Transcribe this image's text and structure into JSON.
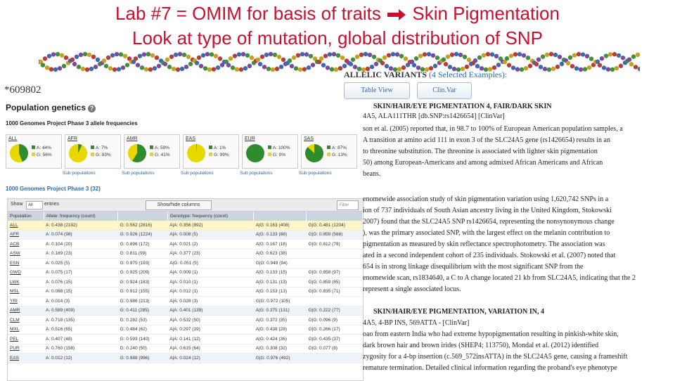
{
  "slide": {
    "title_line1_pre": "Lab #7 = OMIM for basis of traits",
    "title_line1_post": " Skin Pigmentation",
    "title_line2": "Look at type of mutation, global distribution of SNP",
    "title_color": "#c8102e"
  },
  "left": {
    "mim_number": "*609802",
    "pop_gen_title": "Population genetics",
    "kg_label": "1000 Genomes Project Phase 3 allele frequencies",
    "populations": [
      {
        "name": "ALL",
        "a": "A: 44%",
        "g": "G: 56%",
        "a_frac": 0.44
      },
      {
        "name": "AFR",
        "a": "A: 7%",
        "g": "G: 93%",
        "a_frac": 0.07
      },
      {
        "name": "AMR",
        "a": "A: 59%",
        "g": "G: 41%",
        "a_frac": 0.59
      },
      {
        "name": "EAS",
        "a": "A: 1%",
        "g": "G: 99%",
        "a_frac": 0.01
      },
      {
        "name": "EUR",
        "a": "A: 100%",
        "g": "G: 0%",
        "a_frac": 1.0
      },
      {
        "name": "SAS",
        "a": "A: 87%",
        "g": "G: 13%",
        "a_frac": 0.87
      }
    ],
    "subpop_label": "Sub populations",
    "kg32_label": "1000 Genomes Project Phase 3 (32)",
    "table_bar": {
      "show": "Show",
      "select": "All",
      "entries": "entries",
      "show_cols": "Show/hide columns",
      "filter": "Filter"
    },
    "headers": [
      "Population",
      "Allele: frequency (count)",
      "",
      "Genotype: frequency (count)",
      "",
      ""
    ],
    "rows": [
      {
        "cls": "hl",
        "pop": "ALL",
        "a": "A: 0.438 (2192)",
        "g": "G: 0.562 (2816)",
        "aa": "A|A: 0.356 (892)",
        "ag": "A|G: 0.163 (408)",
        "gg": "G|G: 0.481 (1204)"
      },
      {
        "cls": "sub",
        "pop": "AFR",
        "a": "A: 0.074 (98)",
        "g": "G: 0.926 (1224)",
        "aa": "A|A: 0.008 (5)",
        "ag": "A|G: 0.133 (88)",
        "gg": "G|G: 0.859 (568)"
      },
      {
        "cls": "",
        "pop": "ACB",
        "a": "A: 0.104 (20)",
        "g": "G: 0.896 (172)",
        "aa": "A|A: 0.021 (2)",
        "ag": "A|G: 0.167 (16)",
        "gg": "G|G: 0.812 (78)"
      },
      {
        "cls": "",
        "pop": "ASW",
        "a": "A: 0.189 (23)",
        "g": "G: 0.811 (99)",
        "aa": "A|A: 0.377 (23)",
        "ag": "A|G: 0.623 (38)",
        "gg": ""
      },
      {
        "cls": "",
        "pop": "ESN",
        "a": "A: 0.025 (5)",
        "g": "G: 0.975 (193)",
        "aa": "A|G: 0.051 (5)",
        "ag": "G|G: 0.949 (94)",
        "gg": ""
      },
      {
        "cls": "",
        "pop": "GWD",
        "a": "A: 0.075 (17)",
        "g": "G: 0.925 (209)",
        "aa": "A|A: 0.009 (1)",
        "ag": "A|G: 0.133 (15)",
        "gg": "G|G: 0.858 (97)"
      },
      {
        "cls": "",
        "pop": "LWK",
        "a": "A: 0.076 (15)",
        "g": "G: 0.924 (183)",
        "aa": "A|A: 0.010 (1)",
        "ag": "A|G: 0.131 (13)",
        "gg": "G|G: 0.859 (85)"
      },
      {
        "cls": "",
        "pop": "MSL",
        "a": "A: 0.088 (15)",
        "g": "G: 0.912 (155)",
        "aa": "A|A: 0.012 (1)",
        "ag": "A|G: 0.153 (13)",
        "gg": "G|G: 0.835 (71)"
      },
      {
        "cls": "",
        "pop": "YRI",
        "a": "A: 0.014 (3)",
        "g": "G: 0.986 (213)",
        "aa": "A|A: 0.028 (3)",
        "ag": "G|G: 0.972 (105)",
        "gg": ""
      },
      {
        "cls": "sub",
        "pop": "AMR",
        "a": "A: 0.589 (409)",
        "g": "G: 0.411 (285)",
        "aa": "A|A: 0.401 (139)",
        "ag": "A|G: 0.375 (131)",
        "gg": "G|G: 0.222 (77)"
      },
      {
        "cls": "",
        "pop": "CLM",
        "a": "A: 0.718 (135)",
        "g": "G: 0.282 (53)",
        "aa": "A|A: 0.532 (50)",
        "ag": "A|G: 0.372 (35)",
        "gg": "G|G: 0.096 (9)"
      },
      {
        "cls": "",
        "pop": "MXL",
        "a": "A: 0.516 (65)",
        "g": "G: 0.484 (62)",
        "aa": "A|A: 0.297 (19)",
        "ag": "A|G: 0.438 (28)",
        "gg": "G|G: 0.266 (17)"
      },
      {
        "cls": "",
        "pop": "PEL",
        "a": "A: 0.407 (48)",
        "g": "G: 0.593 (140)",
        "aa": "A|A: 0.141 (12)",
        "ag": "A|G: 0.424 (36)",
        "gg": "G|G: 0.435 (37)"
      },
      {
        "cls": "",
        "pop": "PUR",
        "a": "A: 0.760 (158)",
        "g": "G: 0.240 (50)",
        "aa": "A|A: 0.615 (64)",
        "ag": "A|G: 0.308 (32)",
        "gg": "G|G: 0.077 (8)"
      },
      {
        "cls": "sub",
        "pop": "EAS",
        "a": "A: 0.012 (12)",
        "g": "G: 0.988 (996)",
        "aa": "A|A: 0.024 (12)",
        "ag": "G|G: 0.976 (492)",
        "gg": ""
      }
    ]
  },
  "right": {
    "allelic_title": "ALLELIC VARIANTS",
    "allelic_sub": "(4 Selected Examples):",
    "table_view_btn": "Table View",
    "clinvar_btn": "Clin.Var",
    "lines": [
      {
        "t": "SKIN/HAIR/EYE PIGMENTATION 4, FAIR/DARK SKIN",
        "h": true
      },
      {
        "t": "4A5, ALA111THR [db.SNP:rs1426654] [ClinVar]",
        "h": false
      },
      {
        "t": "son et al. (2005) reported that, in 98.7 to 100% of European American population samples, a",
        "h": false
      },
      {
        "t": "A transition at amino acid 111 in exon 3 of the SLC24A5 gene (rs1426654) results in an",
        "h": false
      },
      {
        "t": "to threonine substitution. The threonine is associated with lighter skin pigmentation",
        "h": false
      },
      {
        "t": "50) among European-Americans and among admixed African Americans and African",
        "h": false
      },
      {
        "t": "beans.",
        "h": false
      },
      {
        "t": "enomewide association study of skin pigmentation variation using 1,620,742 SNPs in a",
        "h": false
      },
      {
        "t": "ion of 737 individuals of South Asian ancestry living in the United Kingdom, Stokowski",
        "h": false
      },
      {
        "t": "2007) found that the SLC24A5 SNP rs1426654, representing the nonsynonymous change",
        "h": false
      },
      {
        "t": "), was the primary associated SNP, with the largest effect on the melanin contribution to",
        "h": false
      },
      {
        "t": "pigmentation as measured by skin reflectance spectrophotometry. The association was",
        "h": false
      },
      {
        "t": "ated in a second independent cohort of 235 individuals. Stokowski et al. (2007) noted that",
        "h": false
      },
      {
        "t": "654 is in strong linkage disequilibrium with the most significant SNP from the",
        "h": false
      },
      {
        "t": "enomewide scan, rs1834640, a C to A change located 21 kb from SLC24A5, indicating that the 2",
        "h": false
      },
      {
        "t": "represent a single associated locus.",
        "h": false
      },
      {
        "t": "SKIN/HAIR/EYE PIGMENTATION, VARIATION IN, 4",
        "h": true
      },
      {
        "t": "4A5, 4-BP INS, 569ATTA - [ClinVar]",
        "h": false
      },
      {
        "t": "oao from eastern India who had extreme hypopigmentation resulting in pinkish-white skin,",
        "h": false
      },
      {
        "t": "dark brown hair and brown irides (SHEP4; 113750), Mondal et al. (2012) identified",
        "h": false
      },
      {
        "t": "zygosity for a 4-bp insertion (c.569_572insATTA) in the SLC24A5 gene, causing a frameshift",
        "h": false
      },
      {
        "t": "remature termination. Detailed clinical information regarding the proband's eye phenotype",
        "h": false
      }
    ]
  },
  "colors": {
    "allele_a": "#2e8b2e",
    "allele_g": "#e8d800",
    "link": "#2a6aa9"
  }
}
